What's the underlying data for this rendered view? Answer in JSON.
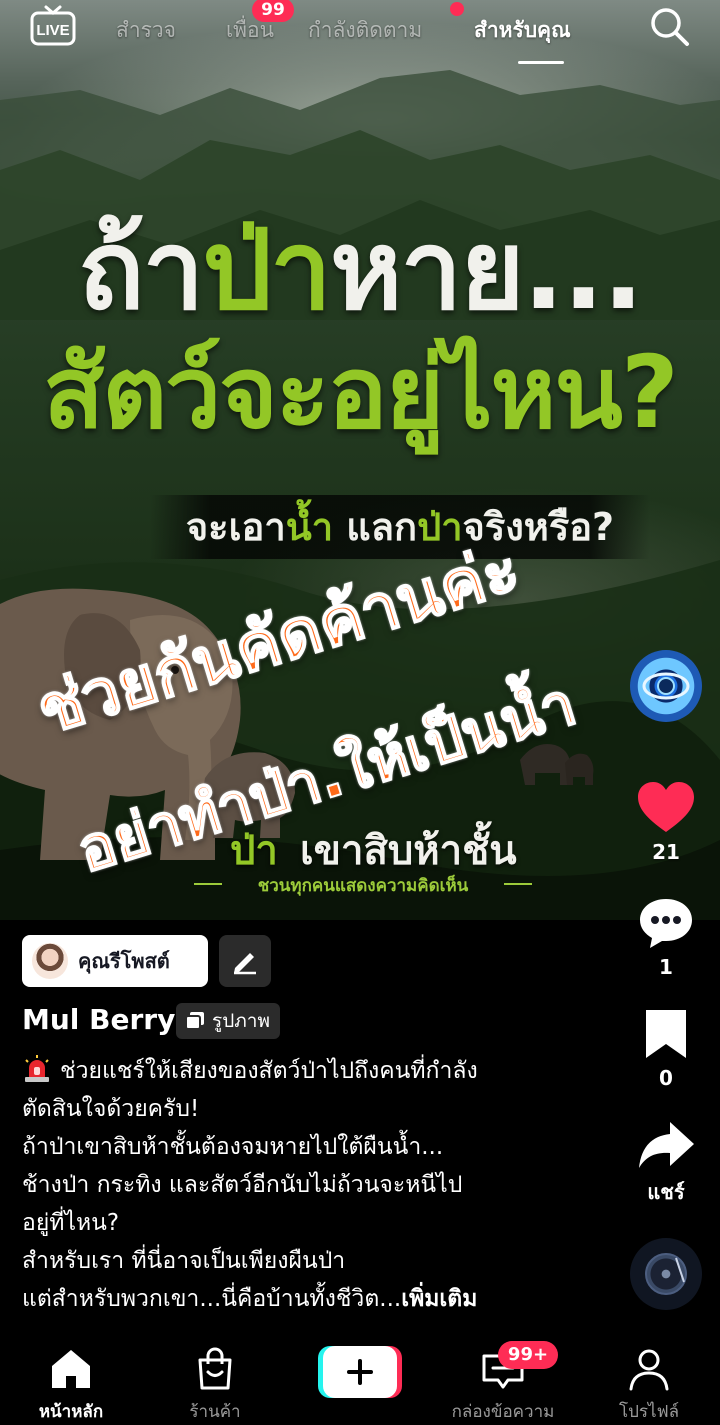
{
  "topbar": {
    "live_label": "LIVE",
    "tabs": [
      {
        "label": "สำรวจ",
        "active": false
      },
      {
        "label": "เพื่อน",
        "active": false,
        "badge": "99"
      },
      {
        "label": "กำลังติดตาม",
        "active": false,
        "dot": true
      },
      {
        "label": "สำหรับคุณ",
        "active": true
      }
    ],
    "search_icon": "search-icon"
  },
  "post_image": {
    "title_line1_white_a": "ถ้า",
    "title_line1_green": "ป่า",
    "title_line1_white_b": "หาย...",
    "title_line2_green": "สัตว์จะอยู่ไหน?",
    "subtitle_a": "จะเอา",
    "subtitle_green_a": "น้ำ",
    "subtitle_b": "แลก",
    "subtitle_green_b": "ป่า",
    "subtitle_c": "จริงหรือ?",
    "location_green": "ป่า",
    "location": "เขาสิบห้าชั้น",
    "tagline": "ชวนทุกคนแสดงความคิดเห็น",
    "overlay_line1": "ช่วยกันคัดค้านค่ะ",
    "overlay_line2": "อย่าทำป่า.ให้เป็นน้ำ",
    "accent_green": "#93c726",
    "overlay_orange": "#ff6a1a"
  },
  "actions": {
    "likes": "21",
    "comments": "1",
    "saves": "0",
    "share_label": "แชร์",
    "like_color": "#fe2c55"
  },
  "post": {
    "repost_label": "คุณรีโพสต์",
    "author": "Mul Berry",
    "type_label": "รูปภาพ",
    "caption_lines": [
      "ช่วยแชร์ให้เสียงของสัตว์ป่าไปถึงคนที่กำลัง",
      "ตัดสินใจด้วยครับ!",
      "ถ้าป่าเขาสิบห้าชั้นต้องจมหายไปใต้ผืนน้ำ...",
      "ช้างป่า กระทิง และสัตว์อีกนับไม่ถ้วนจะหนีไป",
      "อยู่ที่ไหน?",
      "สำหรับเรา ที่นี่อาจเป็นเพียงผืนป่า",
      "แต่สำหรับพวกเขา...นี่คือบ้านทั้งชีวิต..."
    ],
    "more_label": "เพิ่มเติม"
  },
  "bottom_nav": {
    "home": "หน้าหลัก",
    "shop": "ร้านค้า",
    "inbox": "กล่องข้อความ",
    "inbox_badge": "99+",
    "profile": "โปรไฟล์"
  }
}
